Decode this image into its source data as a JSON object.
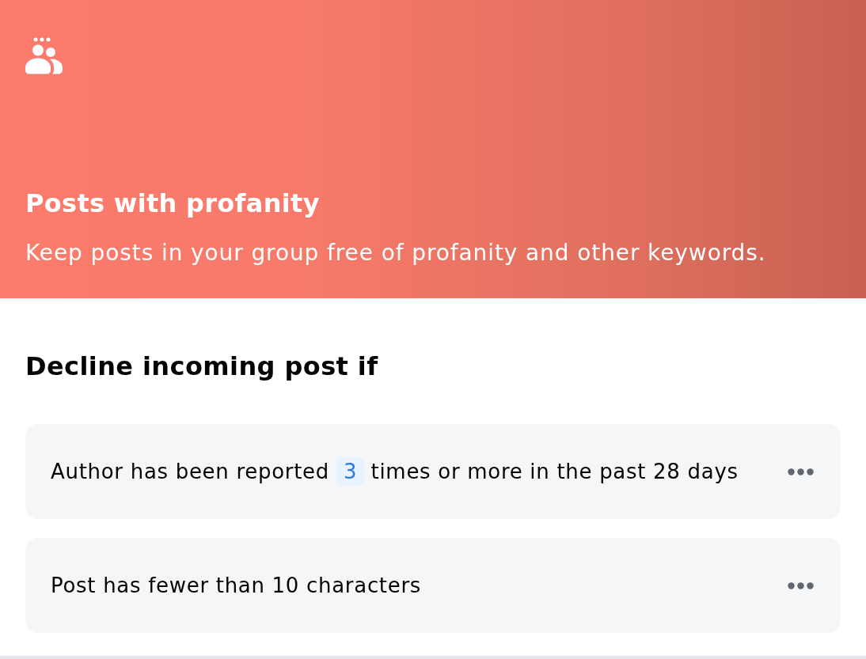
{
  "header": {
    "title": "Posts with profanity",
    "description": "Keep posts in your group free of profanity and other keywords."
  },
  "section": {
    "title": "Decline incoming post if"
  },
  "rules": [
    {
      "kind": "threshold",
      "text_before": "Author has been reported",
      "value": "3",
      "text_after": "times or more in the past 28 days"
    },
    {
      "kind": "plain",
      "text": "Post has fewer than 10 characters"
    }
  ]
}
